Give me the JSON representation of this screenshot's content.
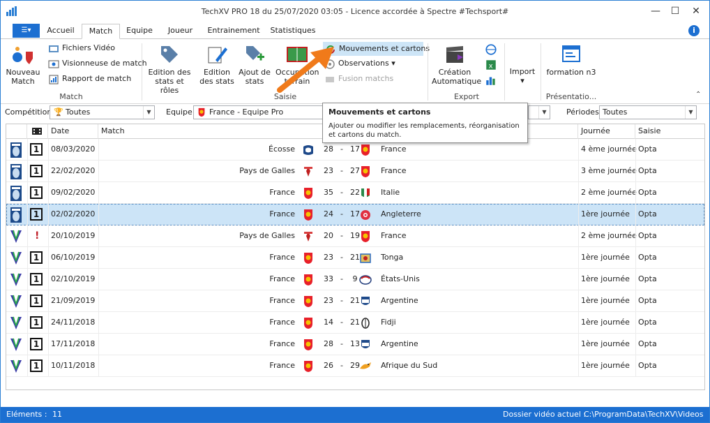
{
  "window": {
    "title": "TechXV PRO 18 du 25/07/2020 03:05 - Licence accordée à Spectre #Techsport#",
    "minimize": "—",
    "maximize": "☐",
    "close": "✕"
  },
  "tabs": {
    "file_icon": "☰▾",
    "items": [
      "Accueil",
      "Match",
      "Equipe",
      "Joueur",
      "Entrainement",
      "Statistiques"
    ],
    "active": "Match",
    "help": "i"
  },
  "ribbon": {
    "nouveau_match": "Nouveau Match",
    "fichiers_video": "Fichiers Vidéo",
    "visionneuse": "Visionneuse de match",
    "rapport": "Rapport de match",
    "group_match": "Match",
    "edition_stats_roles": "Edition des stats et rôles",
    "edition_stats": "Edition des stats",
    "ajout_stats": "Ajout de stats",
    "occupation": "Occupation terrain",
    "mouvements": "Mouvements et cartons",
    "observations": "Observations",
    "fusion": "Fusion matchs",
    "group_saisie": "Saisie",
    "creation_auto": "Création Automatique",
    "group_export": "Export",
    "import": "Import",
    "formation": "formation n3",
    "group_presentation": "Présentatio..."
  },
  "filters": {
    "competition_label": "Compétition",
    "competition_value": "Toutes",
    "equipe_label": "Equipe",
    "equipe_value": "France - Equipe Pro",
    "periodes_label": "Périodes",
    "periodes_value": "Toutes"
  },
  "tooltip": {
    "title": "Mouvements et cartons",
    "body": "Ajouter ou modifier les remplacements, réorganisation et cartons du match."
  },
  "grid": {
    "headers": [
      "Date",
      "Match",
      "Journée",
      "Saisie"
    ],
    "rows": [
      {
        "comp": "six-nations",
        "status": "1",
        "date": "08/03/2020",
        "home": "Écosse",
        "hflag": "scotland",
        "hs": "28",
        "as": "17",
        "aflag": "france",
        "away": "France",
        "journee": "4 ème journée",
        "saisie": "Opta"
      },
      {
        "comp": "six-nations",
        "status": "1",
        "date": "22/02/2020",
        "home": "Pays de Galles",
        "hflag": "wales",
        "hs": "23",
        "as": "27",
        "aflag": "france",
        "away": "France",
        "journee": "3 ème journée",
        "saisie": "Opta"
      },
      {
        "comp": "six-nations",
        "status": "1",
        "date": "09/02/2020",
        "home": "France",
        "hflag": "france",
        "hs": "35",
        "as": "22",
        "aflag": "italy",
        "away": "Italie",
        "journee": "2 ème journée",
        "saisie": "Opta"
      },
      {
        "comp": "six-nations",
        "status": "1",
        "date": "02/02/2020",
        "home": "France",
        "hflag": "france",
        "hs": "24",
        "as": "17",
        "aflag": "england",
        "away": "Angleterre",
        "journee": "1ère journée",
        "saisie": "Opta",
        "selected": true
      },
      {
        "comp": "world-cup",
        "status": "!",
        "date": "20/10/2019",
        "home": "Pays de Galles",
        "hflag": "wales",
        "hs": "20",
        "as": "19",
        "aflag": "france",
        "away": "France",
        "journee": "2 ème journée",
        "saisie": "Opta"
      },
      {
        "comp": "world-cup",
        "status": "1",
        "date": "06/10/2019",
        "home": "France",
        "hflag": "france",
        "hs": "23",
        "as": "21",
        "aflag": "tonga",
        "away": "Tonga",
        "journee": "1ère journée",
        "saisie": "Opta"
      },
      {
        "comp": "world-cup",
        "status": "1",
        "date": "02/10/2019",
        "home": "France",
        "hflag": "france",
        "hs": "33",
        "as": "9",
        "aflag": "usa",
        "away": "États-Unis",
        "journee": "1ère journée",
        "saisie": "Opta"
      },
      {
        "comp": "world-cup",
        "status": "1",
        "date": "21/09/2019",
        "home": "France",
        "hflag": "france",
        "hs": "23",
        "as": "21",
        "aflag": "argentina",
        "away": "Argentine",
        "journee": "1ère journée",
        "saisie": "Opta"
      },
      {
        "comp": "world-cup",
        "status": "1",
        "date": "24/11/2018",
        "home": "France",
        "hflag": "france",
        "hs": "14",
        "as": "21",
        "aflag": "fiji",
        "away": "Fidji",
        "journee": "1ère journée",
        "saisie": "Opta"
      },
      {
        "comp": "world-cup",
        "status": "1",
        "date": "17/11/2018",
        "home": "France",
        "hflag": "france",
        "hs": "28",
        "as": "13",
        "aflag": "argentina",
        "away": "Argentine",
        "journee": "1ère journée",
        "saisie": "Opta"
      },
      {
        "comp": "world-cup",
        "status": "1",
        "date": "10/11/2018",
        "home": "France",
        "hflag": "france",
        "hs": "26",
        "as": "29",
        "aflag": "south-africa",
        "away": "Afrique du Sud",
        "journee": "1ère journée",
        "saisie": "Opta"
      }
    ]
  },
  "status": {
    "elements_label": "Eléments :",
    "elements_value": "11",
    "dossier_label": "Dossier vidéo actuel :",
    "dossier_value": "C:\\ProgramData\\TechXV\\Videos"
  },
  "colors": {
    "accent": "#1c6fd1",
    "selection": "#cce4f7",
    "arrow": "#f07a1a"
  }
}
